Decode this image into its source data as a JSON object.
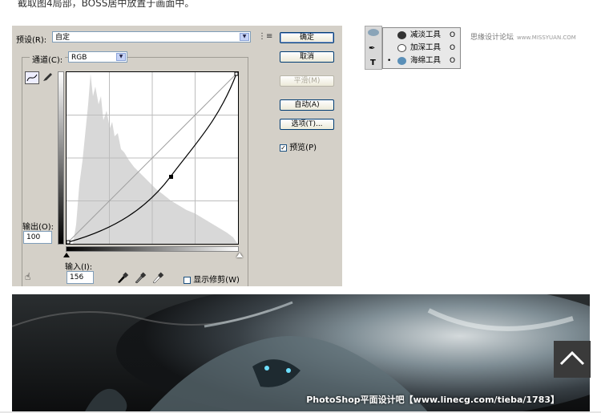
{
  "caption": "截取图4局部，BOSS居中放置于画面中。",
  "curves_dialog": {
    "preset_label": "预设(R):",
    "preset_value": "自定",
    "channel_label": "通道(C):",
    "channel_value": "RGB",
    "buttons": {
      "ok": "确定",
      "cancel": "取消",
      "smooth": "平滑(M)",
      "auto": "自动(A)",
      "options": "选项(T)..."
    },
    "preview_label": "预览(P)",
    "preview_checked": true,
    "output_label": "输出(O):",
    "output_value": "100",
    "input_label": "输入(I):",
    "input_value": "156",
    "show_clipping_label": "显示修剪(W)",
    "show_clipping_checked": false
  },
  "tools_flyout": {
    "items": [
      {
        "name": "减淡工具",
        "key": "O",
        "selected": false
      },
      {
        "name": "加深工具",
        "key": "O",
        "selected": false
      },
      {
        "name": "海绵工具",
        "key": "O",
        "selected": true
      }
    ]
  },
  "site_credit": {
    "text": "思缘设计论坛",
    "url": "www.MISSYUAN.COM"
  },
  "banner": {
    "watermark": "PhotoShop平面设计吧【www.linecg.com/tieba/1783】"
  },
  "colors": {
    "dialog_bg": "#d4d0c8",
    "histogram": "#d8d8d8",
    "button_border": "#003c74"
  }
}
